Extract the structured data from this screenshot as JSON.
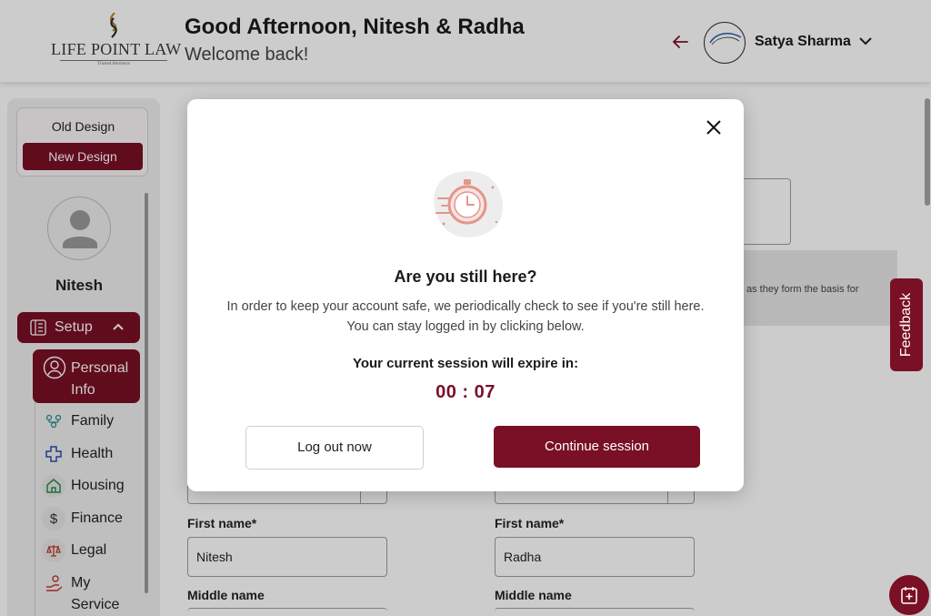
{
  "brand": {
    "name": "LIFE POINT LAW",
    "tagline": "Trusted Attorneys"
  },
  "header": {
    "title": "Good Afternoon, Nitesh & Radha",
    "subtitle": "Welcome back!",
    "user_name": "Satya Sharma"
  },
  "sidebar": {
    "old_design": "Old Design",
    "new_design": "New Design",
    "profile_name": "Nitesh",
    "setup_label": "Setup",
    "items": [
      {
        "label": "Personal Info",
        "icon": "person-icon"
      },
      {
        "label": "Family",
        "icon": "family-icon"
      },
      {
        "label": "Health",
        "icon": "health-cross-icon"
      },
      {
        "label": "Housing",
        "icon": "house-icon"
      },
      {
        "label": "Finance",
        "icon": "dollar-icon"
      },
      {
        "label": "Legal",
        "icon": "scales-icon"
      },
      {
        "label": "My Service",
        "icon": "service-icon"
      }
    ]
  },
  "main": {
    "notice_text": "as they form the basis for",
    "columns": [
      {
        "first_name_label": "First name*",
        "first_name_value": "Nitesh",
        "middle_name_label": "Middle name"
      },
      {
        "first_name_label": "First name*",
        "first_name_value": "Radha",
        "middle_name_label": "Middle name"
      }
    ]
  },
  "feedback_label": "Feedback",
  "modal": {
    "title": "Are you still here?",
    "line1": "In order to keep your account safe, we periodically check to see if you're still here.",
    "line2": "You can stay logged in by clicking below.",
    "expire_label": "Your current session will expire in:",
    "countdown": "00 : 07",
    "logout_label": "Log out now",
    "continue_label": "Continue session"
  },
  "colors": {
    "accent": "#7a1025",
    "overlay": "rgba(0,0,0,0.2)"
  }
}
